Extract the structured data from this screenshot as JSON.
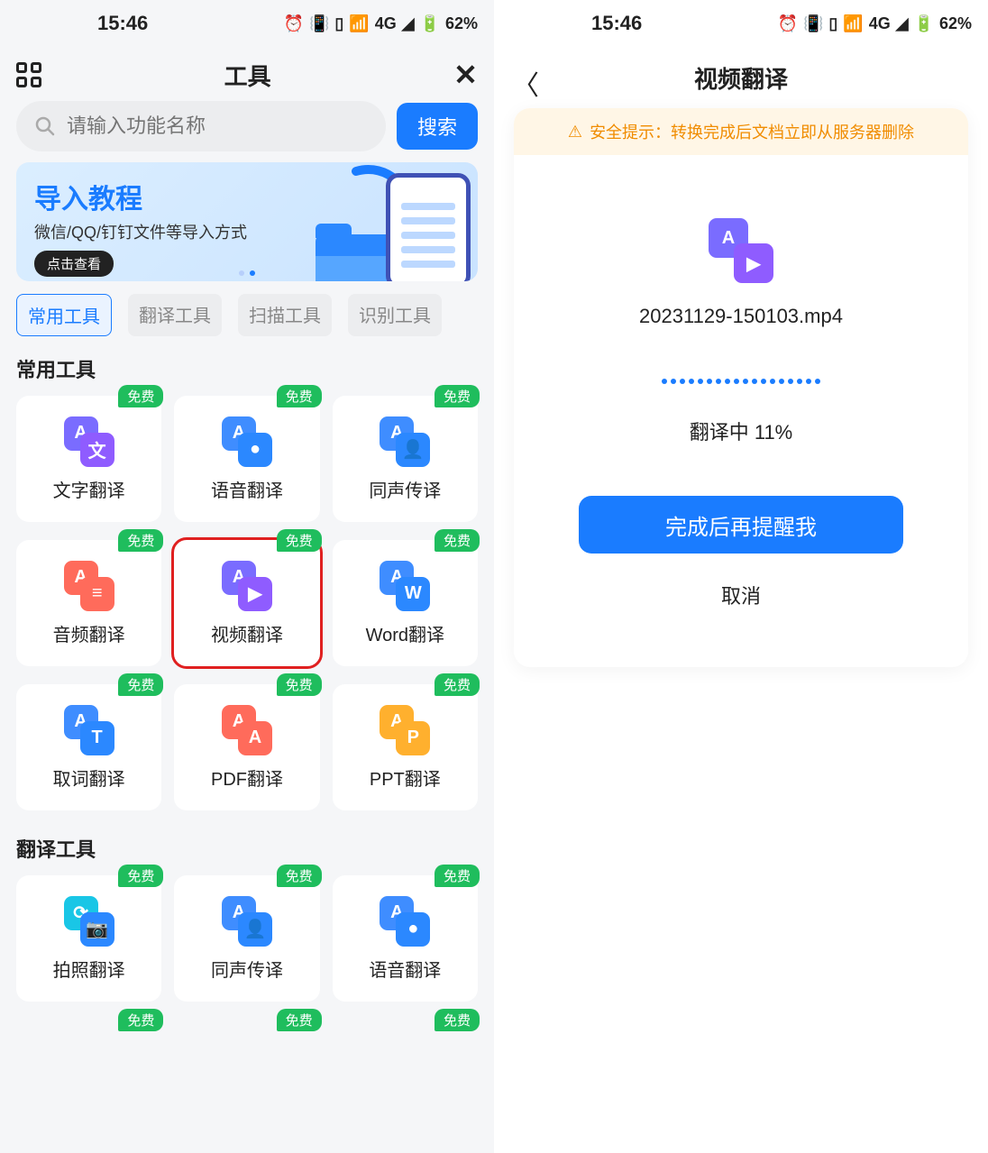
{
  "status": {
    "time": "15:46",
    "network": "4G",
    "battery": "62%"
  },
  "left": {
    "title": "工具",
    "search": {
      "placeholder": "请输入功能名称",
      "button": "搜索"
    },
    "banner": {
      "title": "导入教程",
      "subtitle": "微信/QQ/钉钉文件等导入方式",
      "button": "点击查看"
    },
    "tabs": [
      "常用工具",
      "翻译工具",
      "扫描工具",
      "识别工具"
    ],
    "badge": "免费",
    "sections": [
      {
        "title": "常用工具",
        "items": [
          {
            "label": "文字翻译",
            "back": "c-purple",
            "front": "c-purple2",
            "backGlyph": "A",
            "frontGlyph": "文"
          },
          {
            "label": "语音翻译",
            "back": "c-blue",
            "front": "c-blue2",
            "backGlyph": "A",
            "frontGlyph": "●"
          },
          {
            "label": "同声传译",
            "back": "c-blue",
            "front": "c-blue2",
            "backGlyph": "A",
            "frontGlyph": "👤"
          },
          {
            "label": "音频翻译",
            "back": "c-red",
            "front": "c-red",
            "backGlyph": "A",
            "frontGlyph": "≡"
          },
          {
            "label": "视频翻译",
            "back": "c-purple",
            "front": "c-purple2",
            "backGlyph": "A",
            "frontGlyph": "▶",
            "highlight": true
          },
          {
            "label": "Word翻译",
            "back": "c-blue",
            "front": "c-blue2",
            "backGlyph": "A",
            "frontGlyph": "W"
          },
          {
            "label": "取词翻译",
            "back": "c-blue",
            "front": "c-blue2",
            "backGlyph": "A",
            "frontGlyph": "T"
          },
          {
            "label": "PDF翻译",
            "back": "c-red",
            "front": "c-red",
            "backGlyph": "A",
            "frontGlyph": "A"
          },
          {
            "label": "PPT翻译",
            "back": "c-orange",
            "front": "c-orange",
            "backGlyph": "A",
            "frontGlyph": "P"
          }
        ]
      },
      {
        "title": "翻译工具",
        "items": [
          {
            "label": "拍照翻译",
            "back": "c-teal",
            "front": "c-blue2",
            "backGlyph": "⟳",
            "frontGlyph": "📷"
          },
          {
            "label": "同声传译",
            "back": "c-blue",
            "front": "c-blue2",
            "backGlyph": "A",
            "frontGlyph": "👤"
          },
          {
            "label": "语音翻译",
            "back": "c-blue",
            "front": "c-blue2",
            "backGlyph": "A",
            "frontGlyph": "●"
          }
        ]
      }
    ],
    "partialBadges": [
      "免费",
      "免费",
      "免费"
    ]
  },
  "right": {
    "title": "视频翻译",
    "notice": "安全提示：转换完成后文档立即从服务器删除",
    "file": {
      "name": "20231129-150103.mp4"
    },
    "progress": {
      "text": "翻译中 11%"
    },
    "primaryButton": "完成后再提醒我",
    "cancel": "取消"
  }
}
